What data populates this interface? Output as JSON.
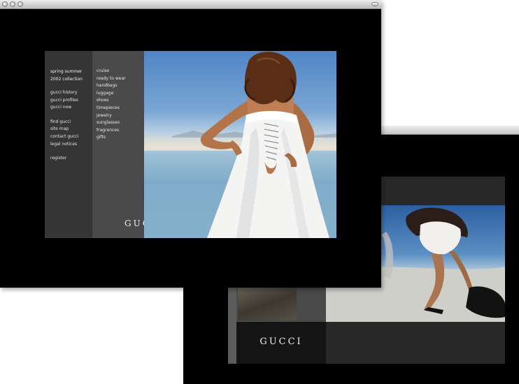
{
  "front": {
    "sidebar": {
      "heading": [
        "spring summer",
        "2002 collection"
      ],
      "links_a": [
        "gucci history",
        "gucci profiles",
        "gucci now"
      ],
      "links_b": [
        "find gucci",
        "site map",
        "contact gucci",
        "legal notices"
      ],
      "links_c": [
        "register"
      ]
    },
    "categories": [
      "cruise",
      "ready to wear",
      "handbags",
      "luggage",
      "shoes",
      "timepieces",
      "jewelry",
      "sunglasses",
      "fragrances",
      "gifts"
    ],
    "logo": "GUCCI"
  },
  "back": {
    "logo": "GUCCI"
  },
  "colors": {
    "page_bg": "#ffffff",
    "site_bg": "#000000",
    "left_column": "#353535",
    "mid_column": "#4a4a4a",
    "sky": "#4f86c6",
    "sea": "#7fa9c9",
    "dress": "#f4f4f2",
    "hair": "#5a2e16",
    "skin": "#b4744a"
  }
}
